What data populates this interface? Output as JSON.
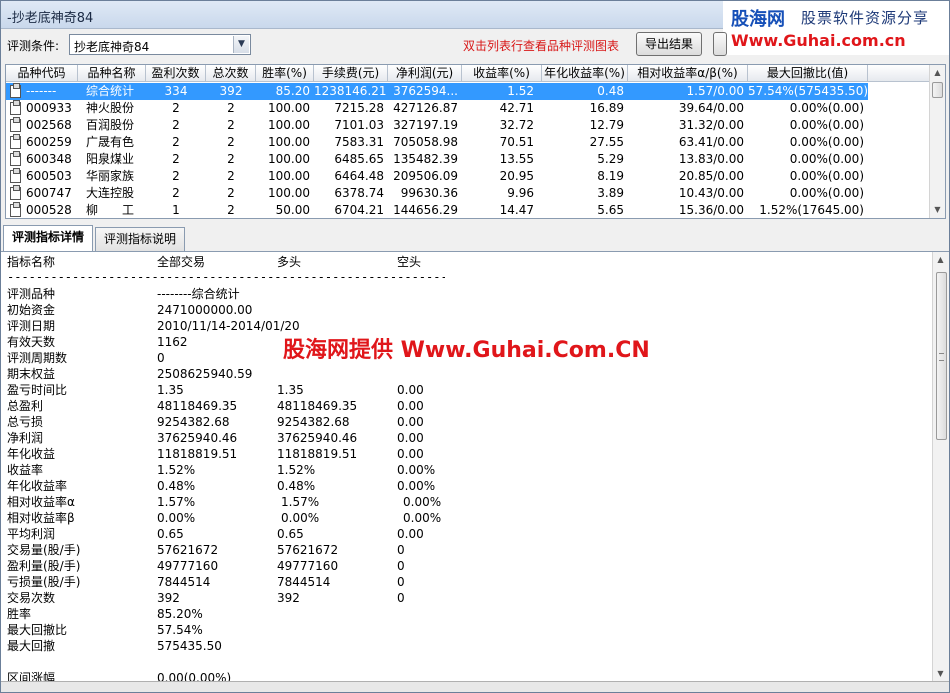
{
  "window": {
    "title": "-抄老底神奇84"
  },
  "watermark": {
    "logo": "股海网",
    "slogan": "股票软件资源分享",
    "url": "Www.Guhai.com.cn",
    "mid_text": "股海网提供 Www.Guhai.Com.CN"
  },
  "toolbar": {
    "condition_label": "评测条件:",
    "condition_value": "抄老底神奇84",
    "hint": "双击列表行查看品种评测图表",
    "export_label": "导出结果"
  },
  "grid": {
    "columns": [
      "品种代码",
      "品种名称",
      "盈利次数",
      "总次数",
      "胜率(%)",
      "手续费(元)",
      "净利润(元)",
      "收益率(%)",
      "年化收益率(%)",
      "相对收益率α/β(%)",
      "最大回撤比(值)"
    ],
    "rows": [
      {
        "code": "-------",
        "name": "综合统计",
        "wins": "334",
        "total": "392",
        "winrate": "85.20",
        "fee": "1238146.21",
        "profit": "3762594...",
        "ret": "1.52",
        "annual": "0.48",
        "rel": "1.57/0.00",
        "maxdd": "57.54%(575435.50)",
        "selected": true
      },
      {
        "code": "000933",
        "name": "神火股份",
        "wins": "2",
        "total": "2",
        "winrate": "100.00",
        "fee": "7215.28",
        "profit": "427126.87",
        "ret": "42.71",
        "annual": "16.89",
        "rel": "39.64/0.00",
        "maxdd": "0.00%(0.00)"
      },
      {
        "code": "002568",
        "name": "百润股份",
        "wins": "2",
        "total": "2",
        "winrate": "100.00",
        "fee": "7101.03",
        "profit": "327197.19",
        "ret": "32.72",
        "annual": "12.79",
        "rel": "31.32/0.00",
        "maxdd": "0.00%(0.00)"
      },
      {
        "code": "600259",
        "name": "广晟有色",
        "wins": "2",
        "total": "2",
        "winrate": "100.00",
        "fee": "7583.31",
        "profit": "705058.98",
        "ret": "70.51",
        "annual": "27.55",
        "rel": "63.41/0.00",
        "maxdd": "0.00%(0.00)"
      },
      {
        "code": "600348",
        "name": "阳泉煤业",
        "wins": "2",
        "total": "2",
        "winrate": "100.00",
        "fee": "6485.65",
        "profit": "135482.39",
        "ret": "13.55",
        "annual": "5.29",
        "rel": "13.83/0.00",
        "maxdd": "0.00%(0.00)"
      },
      {
        "code": "600503",
        "name": "华丽家族",
        "wins": "2",
        "total": "2",
        "winrate": "100.00",
        "fee": "6464.48",
        "profit": "209506.09",
        "ret": "20.95",
        "annual": "8.19",
        "rel": "20.85/0.00",
        "maxdd": "0.00%(0.00)"
      },
      {
        "code": "600747",
        "name": "大连控股",
        "wins": "2",
        "total": "2",
        "winrate": "100.00",
        "fee": "6378.74",
        "profit": "99630.36",
        "ret": "9.96",
        "annual": "3.89",
        "rel": "10.43/0.00",
        "maxdd": "0.00%(0.00)"
      },
      {
        "code": "000528",
        "name": "柳　　工",
        "wins": "1",
        "total": "2",
        "winrate": "50.00",
        "fee": "6704.21",
        "profit": "144656.29",
        "ret": "14.47",
        "annual": "5.65",
        "rel": "15.36/0.00",
        "maxdd": "1.52%(17645.00)"
      }
    ]
  },
  "tabs": [
    {
      "label": "评测指标详情",
      "active": true
    },
    {
      "label": "评测指标说明",
      "active": false
    }
  ],
  "detail": {
    "headers": [
      "指标名称",
      "全部交易",
      "多头",
      "空头"
    ],
    "separator": "------------------------------------------------------------------------------------------",
    "rows": [
      [
        "评测品种",
        "--------综合统计",
        "",
        ""
      ],
      [
        "初始资金",
        "2471000000.00",
        "",
        ""
      ],
      [
        "评测日期",
        "2010/11/14-2014/01/20",
        "",
        ""
      ],
      [
        "有效天数",
        "1162",
        "",
        ""
      ],
      [
        "评测周期数",
        "0",
        "",
        ""
      ],
      [
        "期末权益",
        "2508625940.59",
        "",
        ""
      ],
      [
        "盈亏时间比",
        "1.35",
        "1.35",
        "0.00"
      ],
      [
        "总盈利",
        "48118469.35",
        "48118469.35",
        "0.00"
      ],
      [
        "总亏损",
        "9254382.68",
        "9254382.68",
        "0.00"
      ],
      [
        "净利润",
        "37625940.46",
        "37625940.46",
        "0.00"
      ],
      [
        "年化收益",
        "11818819.51",
        "11818819.51",
        "0.00"
      ],
      [
        "收益率",
        "1.52%",
        "1.52%",
        "0.00%"
      ],
      [
        "年化收益率",
        "0.48%",
        "0.48%",
        "0.00%"
      ],
      [
        "相对收益率α",
        "1.57%",
        "1.57%",
        "0.00%"
      ],
      [
        "相对收益率β",
        "0.00%",
        "0.00%",
        "0.00%"
      ],
      [
        "平均利润",
        "0.65",
        "0.65",
        "0.00"
      ],
      [
        "交易量(股/手)",
        "57621672",
        "57621672",
        "0"
      ],
      [
        "盈利量(股/手)",
        "49777160",
        "49777160",
        "0"
      ],
      [
        "亏损量(股/手)",
        "7844514",
        "7844514",
        "0"
      ],
      [
        "交易次数",
        "392",
        "392",
        "0"
      ],
      [
        "胜率",
        "85.20%",
        "",
        ""
      ],
      [
        "最大回撤比",
        "57.54%",
        "",
        ""
      ],
      [
        "最大回撤",
        "575435.50",
        "",
        ""
      ],
      [
        "",
        "",
        "",
        ""
      ],
      [
        "区间涨幅",
        "0.00(0.00%)",
        "",
        ""
      ]
    ]
  }
}
